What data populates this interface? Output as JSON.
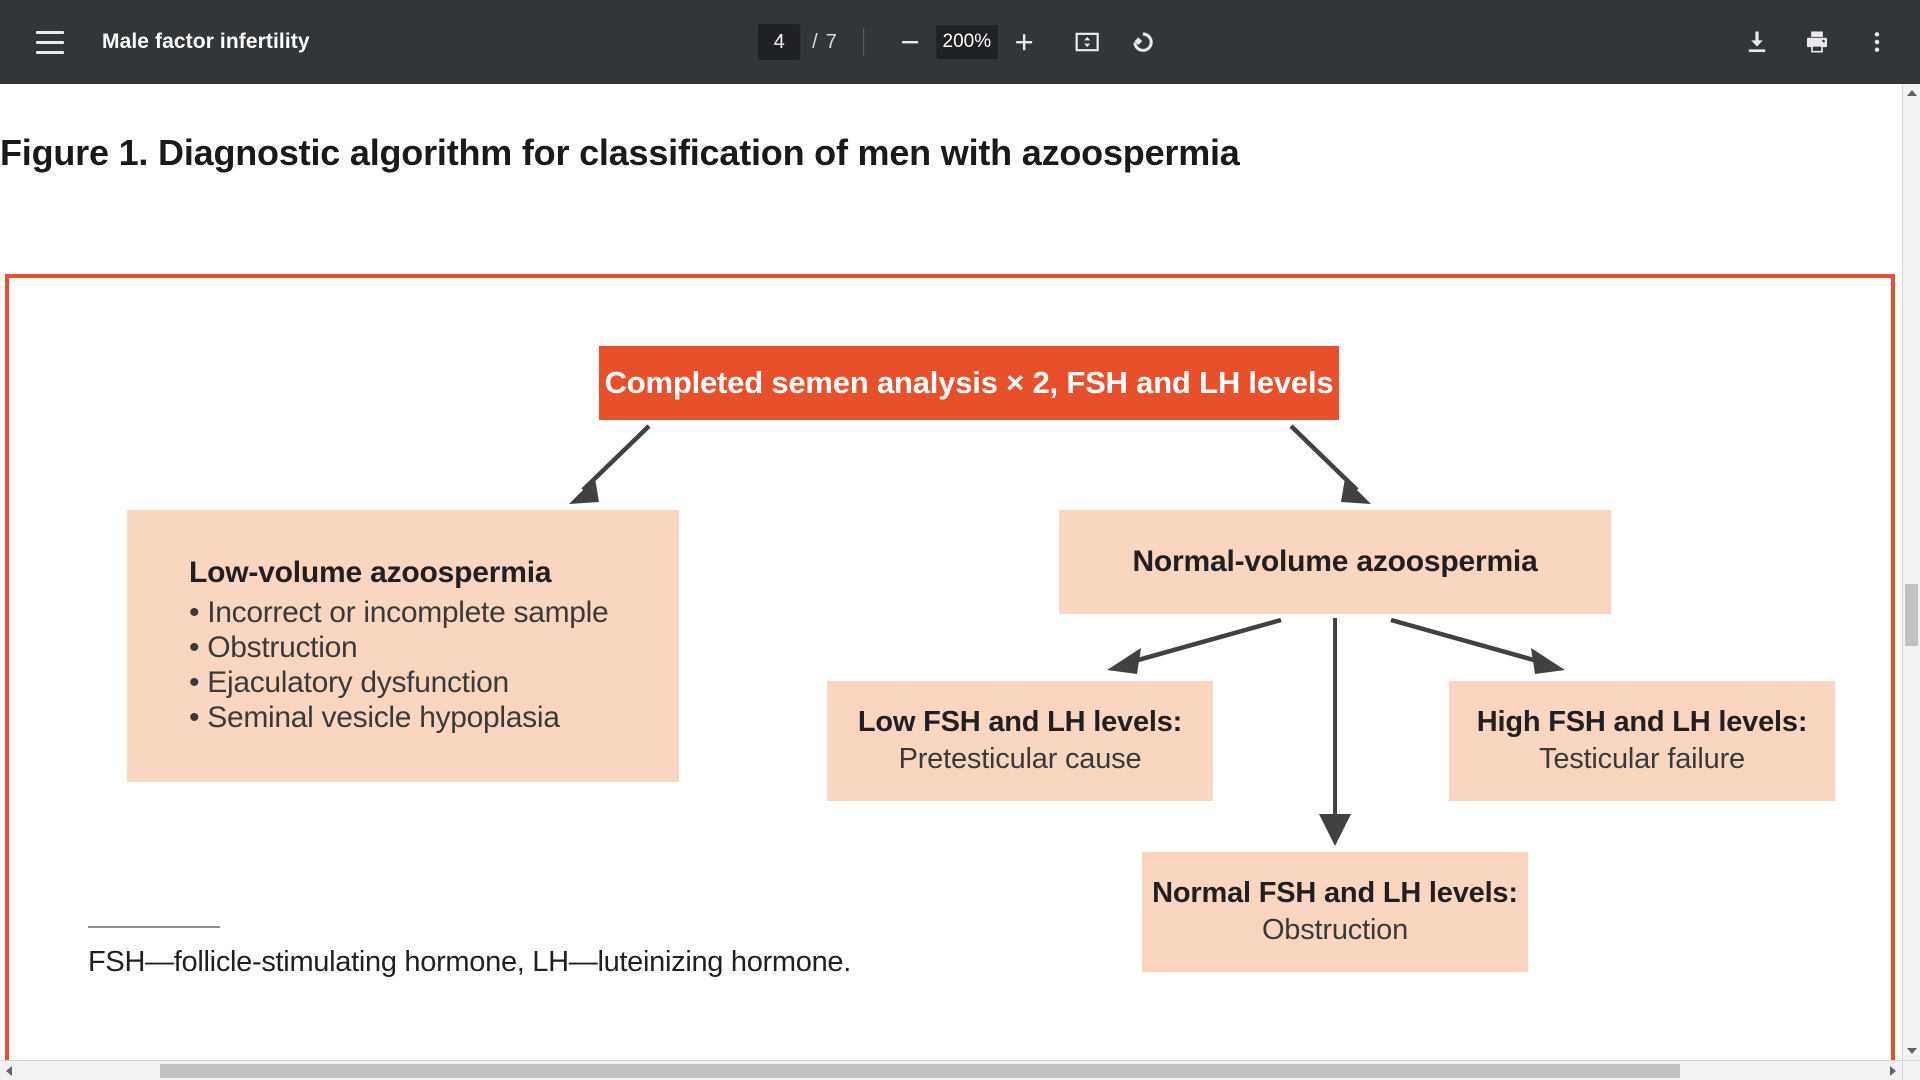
{
  "toolbar": {
    "menu_icon": "hamburger-menu-icon",
    "doc_title": "Male factor infertility",
    "page_current": "4",
    "page_separator": "/",
    "page_total": "7",
    "zoom_out_icon": "minus-icon",
    "zoom_level": "200%",
    "zoom_in_icon": "plus-icon",
    "fit_page_icon": "fit-to-page-icon",
    "rotate_icon": "rotate-counterclockwise-icon",
    "download_icon": "download-icon",
    "print_icon": "print-icon",
    "more_icon": "more-options-icon"
  },
  "figure": {
    "label": "Figure 1.",
    "caption": "Diagnostic algorithm for classification of men with azoospermia",
    "border_color": "#e8502c",
    "root_fill": "#e8502c",
    "node_fill": "#f9d6c2",
    "arrow_color": "#414042",
    "nodes": {
      "root": {
        "header": "Completed semen analysis × 2, FSH and LH levels"
      },
      "low_volume": {
        "header": "Low-volume azoospermia",
        "bullets": [
          "• Incorrect or incomplete sample",
          "• Obstruction",
          "• Ejaculatory dysfunction",
          "• Seminal vesicle hypoplasia"
        ]
      },
      "normal_volume": {
        "header": "Normal-volume azoospermia"
      },
      "low_fsh": {
        "header": "Low FSH and LH levels:",
        "sub": "Pretesticular cause"
      },
      "high_fsh": {
        "header": "High FSH and LH levels:",
        "sub": "Testicular failure"
      },
      "normal_fsh": {
        "header": "Normal FSH and LH levels:",
        "sub": "Obstruction"
      }
    },
    "footnote": "FSH—follicle-stimulating hormone, LH—luteinizing hormone."
  },
  "scrollbars": {
    "vertical_up_icon": "scroll-up-arrow-icon",
    "vertical_down_icon": "scroll-down-arrow-icon",
    "horizontal_left_icon": "scroll-left-arrow-icon",
    "horizontal_right_icon": "scroll-right-arrow-icon"
  }
}
